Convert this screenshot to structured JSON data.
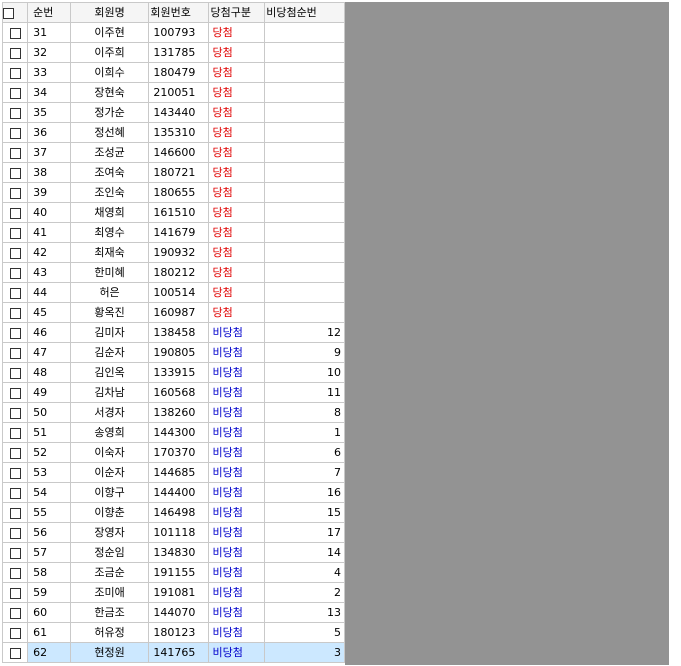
{
  "grid": {
    "headers": {
      "no": "순번",
      "name": "회원명",
      "member_no": "회원번호",
      "type": "당첨구분",
      "order": "비당첨순번"
    },
    "colors": {
      "win": "#e00000",
      "lose": "#0000cc",
      "selected_row": "#cce8ff"
    },
    "rows": [
      {
        "no": "31",
        "name": "이주현",
        "member_no": "100793",
        "type": "당첨",
        "order": "",
        "kind": "win"
      },
      {
        "no": "32",
        "name": "이주희",
        "member_no": "131785",
        "type": "당첨",
        "order": "",
        "kind": "win"
      },
      {
        "no": "33",
        "name": "이희수",
        "member_no": "180479",
        "type": "당첨",
        "order": "",
        "kind": "win"
      },
      {
        "no": "34",
        "name": "장현숙",
        "member_no": "210051",
        "type": "당첨",
        "order": "",
        "kind": "win"
      },
      {
        "no": "35",
        "name": "정가순",
        "member_no": "143440",
        "type": "당첨",
        "order": "",
        "kind": "win"
      },
      {
        "no": "36",
        "name": "정선혜",
        "member_no": "135310",
        "type": "당첨",
        "order": "",
        "kind": "win"
      },
      {
        "no": "37",
        "name": "조성균",
        "member_no": "146600",
        "type": "당첨",
        "order": "",
        "kind": "win"
      },
      {
        "no": "38",
        "name": "조여숙",
        "member_no": "180721",
        "type": "당첨",
        "order": "",
        "kind": "win"
      },
      {
        "no": "39",
        "name": "조인숙",
        "member_no": "180655",
        "type": "당첨",
        "order": "",
        "kind": "win"
      },
      {
        "no": "40",
        "name": "채영희",
        "member_no": "161510",
        "type": "당첨",
        "order": "",
        "kind": "win"
      },
      {
        "no": "41",
        "name": "최영수",
        "member_no": "141679",
        "type": "당첨",
        "order": "",
        "kind": "win"
      },
      {
        "no": "42",
        "name": "최재숙",
        "member_no": "190932",
        "type": "당첨",
        "order": "",
        "kind": "win"
      },
      {
        "no": "43",
        "name": "한미혜",
        "member_no": "180212",
        "type": "당첨",
        "order": "",
        "kind": "win"
      },
      {
        "no": "44",
        "name": "허은",
        "member_no": "100514",
        "type": "당첨",
        "order": "",
        "kind": "win"
      },
      {
        "no": "45",
        "name": "황옥진",
        "member_no": "160987",
        "type": "당첨",
        "order": "",
        "kind": "win"
      },
      {
        "no": "46",
        "name": "김미자",
        "member_no": "138458",
        "type": "비당첨",
        "order": "12",
        "kind": "lose"
      },
      {
        "no": "47",
        "name": "김순자",
        "member_no": "190805",
        "type": "비당첨",
        "order": "9",
        "kind": "lose"
      },
      {
        "no": "48",
        "name": "김인옥",
        "member_no": "133915",
        "type": "비당첨",
        "order": "10",
        "kind": "lose"
      },
      {
        "no": "49",
        "name": "김차남",
        "member_no": "160568",
        "type": "비당첨",
        "order": "11",
        "kind": "lose"
      },
      {
        "no": "50",
        "name": "서경자",
        "member_no": "138260",
        "type": "비당첨",
        "order": "8",
        "kind": "lose"
      },
      {
        "no": "51",
        "name": "송영희",
        "member_no": "144300",
        "type": "비당첨",
        "order": "1",
        "kind": "lose"
      },
      {
        "no": "52",
        "name": "이숙자",
        "member_no": "170370",
        "type": "비당첨",
        "order": "6",
        "kind": "lose"
      },
      {
        "no": "53",
        "name": "이순자",
        "member_no": "144685",
        "type": "비당첨",
        "order": "7",
        "kind": "lose"
      },
      {
        "no": "54",
        "name": "이향구",
        "member_no": "144400",
        "type": "비당첨",
        "order": "16",
        "kind": "lose"
      },
      {
        "no": "55",
        "name": "이향춘",
        "member_no": "146498",
        "type": "비당첨",
        "order": "15",
        "kind": "lose"
      },
      {
        "no": "56",
        "name": "장영자",
        "member_no": "101118",
        "type": "비당첨",
        "order": "17",
        "kind": "lose"
      },
      {
        "no": "57",
        "name": "정순임",
        "member_no": "134830",
        "type": "비당첨",
        "order": "14",
        "kind": "lose"
      },
      {
        "no": "58",
        "name": "조금순",
        "member_no": "191155",
        "type": "비당첨",
        "order": "4",
        "kind": "lose"
      },
      {
        "no": "59",
        "name": "조미애",
        "member_no": "191081",
        "type": "비당첨",
        "order": "2",
        "kind": "lose"
      },
      {
        "no": "60",
        "name": "한금조",
        "member_no": "144070",
        "type": "비당첨",
        "order": "13",
        "kind": "lose"
      },
      {
        "no": "61",
        "name": "허유정",
        "member_no": "180123",
        "type": "비당첨",
        "order": "5",
        "kind": "lose"
      },
      {
        "no": "62",
        "name": "현정원",
        "member_no": "141765",
        "type": "비당첨",
        "order": "3",
        "kind": "lose",
        "selected": true
      }
    ]
  }
}
